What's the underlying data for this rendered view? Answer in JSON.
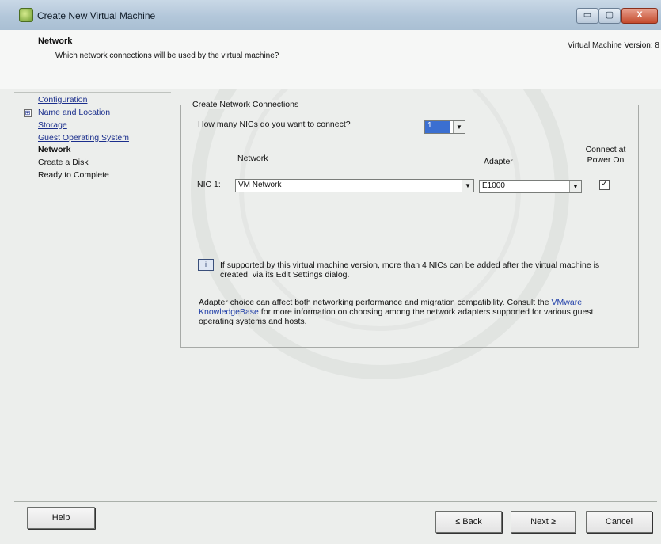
{
  "window": {
    "title": "Create New Virtual Machine",
    "app_icon": "vsphere-icon",
    "controls": {
      "minimize": "▭",
      "maximize": "▢",
      "close": "X"
    }
  },
  "header": {
    "title": "Network",
    "subtitle": "Which network connections will be used by the virtual machine?",
    "version": "Virtual Machine Version: 8"
  },
  "sidebar": {
    "items": [
      {
        "label": "Configuration",
        "state": "link"
      },
      {
        "label": "Name and Location",
        "state": "link",
        "expander": "⊞"
      },
      {
        "label": "Storage",
        "state": "link"
      },
      {
        "label": "Guest Operating System",
        "state": "link"
      },
      {
        "label": "Network",
        "state": "current"
      },
      {
        "label": "Create a Disk",
        "state": "pending"
      },
      {
        "label": "Ready to Complete",
        "state": "pending"
      }
    ]
  },
  "group": {
    "legend": "Create Network Connections",
    "nic_count_question": "How many NICs do you want to connect?",
    "nic_count_value": "1",
    "col_network": "Network",
    "col_adapter": "Adapter",
    "col_connect": "Connect at Power On",
    "nic1_label": "NIC 1:",
    "nic1_network": "VM Network",
    "nic1_adapter": "E1000",
    "nic1_connect": true,
    "connect_check": "✓",
    "info_text": "If supported by this virtual machine version, more than 4 NICs can be added after the virtual machine is created, via its Edit Settings dialog.",
    "note_before": "Adapter choice can affect both networking performance and migration compatibility. Consult the ",
    "note_link": "VMware KnowledgeBase",
    "note_after": " for more information on choosing among the network adapters supported for various guest operating systems and hosts."
  },
  "footer": {
    "help": "Help",
    "back": "≤ Back",
    "next": "Next ≥",
    "cancel": "Cancel"
  },
  "colors": {
    "accent": "#3b6fd1",
    "link": "#1a2e8c",
    "titlebar": "#b3c7da"
  }
}
